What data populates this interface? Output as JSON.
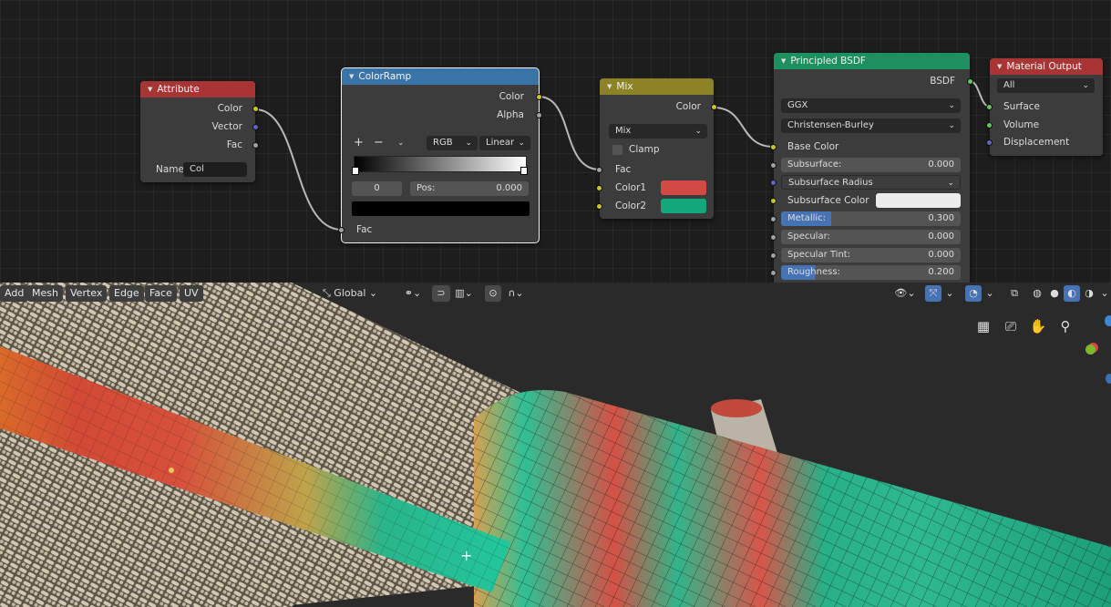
{
  "nodes": {
    "attribute": {
      "title": "Attribute",
      "outputs": [
        "Color",
        "Vector",
        "Fac"
      ],
      "name_label": "Name",
      "name_value": "Col"
    },
    "colorramp": {
      "title": "ColorRamp",
      "outputs": [
        "Color",
        "Alpha"
      ],
      "plus": "+",
      "minus": "−",
      "mode": "RGB",
      "interp": "Linear",
      "stop_index": "0",
      "pos_label": "Pos:",
      "pos_value": "0.000",
      "input": "Fac"
    },
    "mix": {
      "title": "Mix",
      "output": "Color",
      "blend": "Mix",
      "clamp": "Clamp",
      "fac": "Fac",
      "color1": "Color1",
      "color2": "Color2",
      "color1_hex": "#d24a43",
      "color2_hex": "#12a87c"
    },
    "principled": {
      "title": "Principled BSDF",
      "output": "BSDF",
      "distribution": "GGX",
      "sss_method": "Christensen-Burley",
      "base_color": "Base Color",
      "subsurface_label": "Subsurface:",
      "subsurface_value": "0.000",
      "sss_radius": "Subsurface Radius",
      "sss_color": "Subsurface Color",
      "metallic_label": "Metallic:",
      "metallic_value": "0.300",
      "specular_label": "Specular:",
      "specular_value": "0.000",
      "spec_tint_label": "Specular Tint:",
      "spec_tint_value": "0.000",
      "roughness_label": "Roughness:",
      "roughness_value": "0.200"
    },
    "output": {
      "title": "Material Output",
      "target": "All",
      "inputs": [
        "Surface",
        "Volume",
        "Displacement"
      ]
    }
  },
  "header_colors": {
    "attribute": "#a83434",
    "colorramp": "#3a73a8",
    "mix": "#8e8226",
    "principled": "#1e8f5e",
    "output": "#a83434"
  },
  "viewport": {
    "menus": [
      "Add",
      "Mesh",
      "Vertex",
      "Edge",
      "Face",
      "UV"
    ],
    "orientation": "Global"
  },
  "icons": [
    "transform-orientation-icon",
    "pivot-icon",
    "snap-icon",
    "snap-target-icon",
    "proportional-edit-icon",
    "falloff-icon",
    "visibility-icon",
    "gizmo-icon",
    "overlay-icon",
    "xray-icon",
    "wireframe-shading-icon",
    "solid-shading-icon",
    "material-shading-icon",
    "rendered-shading-icon",
    "grid-view-icon",
    "camera-view-icon",
    "hand-pan-icon",
    "zoom-icon"
  ]
}
